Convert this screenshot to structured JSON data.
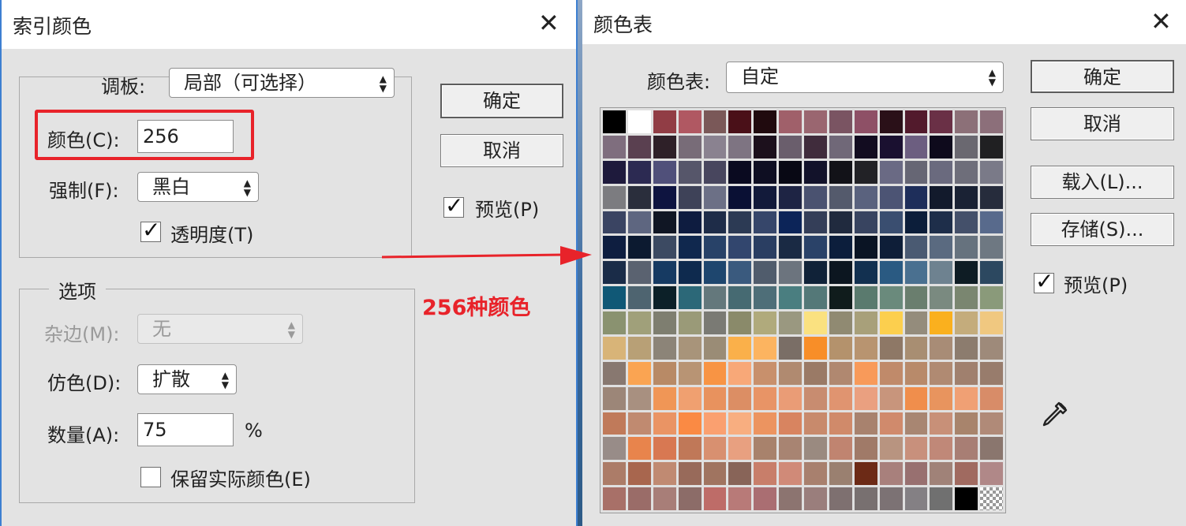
{
  "indexed_dialog": {
    "title": "索引颜色",
    "palette_label": "调板:",
    "palette_value": "局部（可选择）",
    "colors_label": "颜色(C):",
    "colors_value": "256",
    "forced_label": "强制(F):",
    "forced_value": "黑白",
    "transparency_label": "透明度(T)",
    "transparency_checked": true,
    "options_title": "选项",
    "matte_label": "杂边(M):",
    "matte_value": "无",
    "dither_label": "仿色(D):",
    "dither_value": "扩散",
    "amount_label": "数量(A):",
    "amount_value": "75",
    "amount_unit": "%",
    "preserve_label": "保留实际颜色(E)",
    "preserve_checked": false,
    "ok_label": "确定",
    "cancel_label": "取消",
    "preview_label": "预览(P)",
    "preview_checked": true
  },
  "annotation": {
    "text": "256种颜色",
    "color": "#e8232a"
  },
  "color_table_dialog": {
    "title": "颜色表",
    "table_label": "颜色表:",
    "table_value": "自定",
    "ok_label": "确定",
    "cancel_label": "取消",
    "load_label": "载入(L)...",
    "save_label": "存储(S)...",
    "preview_label": "预览(P)",
    "preview_checked": true
  },
  "swatches": [
    "#000000",
    "#ffffff",
    "#913d45",
    "#b05862",
    "#7a5858",
    "#4a1018",
    "#200a0e",
    "#a0606a",
    "#9a6670",
    "#7a5462",
    "#8e5066",
    "#2a1018",
    "#521a2c",
    "#6a3046",
    "#8c7078",
    "#8c6f7a",
    "#7f6e7e",
    "#5a4050",
    "#2e2028",
    "#786c78",
    "#8a8290",
    "#7e7482",
    "#1c101c",
    "#6a5e6c",
    "#402c3c",
    "#706878",
    "#120c20",
    "#1a1030",
    "#6c5e80",
    "#0e0a1c",
    "#6a6870",
    "#202022",
    "#1e1a3c",
    "#2c2a52",
    "#50507a",
    "#56566a",
    "#48465e",
    "#0a0a20",
    "#0e0e22",
    "#080814",
    "#12122a",
    "#121218",
    "#222226",
    "#6a6a84",
    "#666674",
    "#6a6a7e",
    "#6e6e7a",
    "#7a7a88",
    "#7c7c80",
    "#2a2e3c",
    "#0e1440",
    "#3e4258",
    "#6c7086",
    "#0a1034",
    "#121a3a",
    "#1e2444",
    "#4a5270",
    "#545a6c",
    "#5a627e",
    "#4c5474",
    "#1e2e5a",
    "#121a2c",
    "#1a2234",
    "#262c3c",
    "#3a4462",
    "#5e6680",
    "#101624",
    "#0e1c40",
    "#1e2c48",
    "#2c3a54",
    "#36466a",
    "#0c2458",
    "#343e58",
    "#202a3e",
    "#384460",
    "#3a4e70",
    "#0c1e3a",
    "#1e2e4a",
    "#44506a",
    "#586a8c",
    "#0e1e40",
    "#0c1a30",
    "#3c4a62",
    "#10284e",
    "#284268",
    "#32466e",
    "#2a3e62",
    "#1a2a44",
    "#2a4268",
    "#0c1e3c",
    "#0a1424",
    "#0e1e38",
    "#4a5a72",
    "#5a6a80",
    "#66727e",
    "#6e7882",
    "#1a2c48",
    "#5a6270",
    "#163a62",
    "#0e2a4e",
    "#1e466e",
    "#3a5a7e",
    "#505c6c",
    "#6c747e",
    "#102238",
    "#0c1620",
    "#123050",
    "#2a5a82",
    "#4a7090",
    "#6e8290",
    "#0e1c24",
    "#2c4860",
    "#105876",
    "#4e6470",
    "#0c2028",
    "#2c6878",
    "#64787c",
    "#466a72",
    "#4e6e78",
    "#4a7e80",
    "#547878",
    "#101c1c",
    "#5a7a6e",
    "#6a8a7c",
    "#6a7e6e",
    "#7a8a80",
    "#7a8670",
    "#8a9a7a",
    "#8a9270",
    "#a0a07a",
    "#7e7e70",
    "#9a9a78",
    "#7a7a74",
    "#8a8a6a",
    "#b0aa7c",
    "#9a9880",
    "#fae180",
    "#908a72",
    "#a8a07a",
    "#fccf4e",
    "#948c7c",
    "#fab01e",
    "#c4ac7c",
    "#f0c880",
    "#d8b478",
    "#b8a076",
    "#8c8478",
    "#a8947a",
    "#9a8c76",
    "#fab04a",
    "#fcb460",
    "#7a6e66",
    "#f88e28",
    "#b4926c",
    "#b89470",
    "#8e7866",
    "#a88e72",
    "#a88c76",
    "#8c7c6e",
    "#9e8a7a",
    "#887870",
    "#faa452",
    "#b88a66",
    "#b89474",
    "#f89444",
    "#f8a878",
    "#c8906c",
    "#b08a70",
    "#9a7a66",
    "#b08870",
    "#f89a5a",
    "#c08a6a",
    "#b88a6a",
    "#b08a72",
    "#a0806e",
    "#987c6c",
    "#9c8678",
    "#a89080",
    "#f09656",
    "#f0a070",
    "#e8925e",
    "#dc8e64",
    "#e89466",
    "#ea9c76",
    "#c88c70",
    "#e09470",
    "#eaa080",
    "#c8957c",
    "#f08e4c",
    "#e8945e",
    "#f0a074",
    "#d88c68",
    "#c07a5a",
    "#c08a70",
    "#ea9464",
    "#fa8a44",
    "#faa070",
    "#f8ae80",
    "#ec9460",
    "#d88460",
    "#c88a6c",
    "#d08a6a",
    "#a8826e",
    "#d08a6c",
    "#a88672",
    "#c89078",
    "#a8846c",
    "#b08a78",
    "#988c88",
    "#e8844c",
    "#d87852",
    "#c07858",
    "#d89070",
    "#e8a080",
    "#a8826c",
    "#a88472",
    "#9a8a80",
    "#c08470",
    "#a07a68",
    "#b89480",
    "#c8907c",
    "#c08878",
    "#a87e74",
    "#8a766e",
    "#ac7c68",
    "#a8664e",
    "#c08a72",
    "#986a5a",
    "#a07460",
    "#886458",
    "#c87e6a",
    "#d08a78",
    "#a8806e",
    "#9a8070",
    "#6c2a16",
    "#a8807c",
    "#987070",
    "#a08278",
    "#a06a60",
    "#b08888",
    "#a87068",
    "#9a6c68",
    "#a87e78",
    "#8c6c68",
    "#be6c68",
    "#b87a78",
    "#aa6e72",
    "#8c7470",
    "#9a7e7c",
    "#7e7070",
    "#787070",
    "#7c7274",
    "#848084",
    "#707070",
    "#000000",
    "transparent"
  ]
}
